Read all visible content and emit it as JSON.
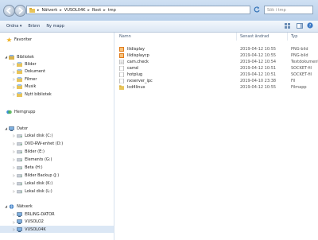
{
  "address": {
    "crumbs": [
      "Nätverk",
      "VUSOL04K",
      "Root",
      "tmp"
    ],
    "search_placeholder": "Sök i tmp"
  },
  "toolbar": {
    "organize": "Ordna ▾",
    "burn": "Bränn",
    "new_folder": "Ny mapp"
  },
  "navigation": {
    "favorites": "Favoriter",
    "libraries": "Bibliotek",
    "library_items": [
      "Bilder",
      "Dokument",
      "Filmer",
      "Musik",
      "Nytt bibliotek"
    ],
    "homegroup": "Hemgrupp",
    "computer": "Dator",
    "drives": [
      "Lokal disk (C:)",
      "DVD-RW-enhet (D:)",
      "Bilder (E:)",
      "Elements (G:)",
      "Beta (H:)",
      "Bilder Backup (J:)",
      "Lokal disk (K:)",
      "Lokal disk (L:)"
    ],
    "network": "Nätverk",
    "network_items": [
      "ERLING-DATOR",
      "VUSOLO2",
      "VUSOL04K"
    ]
  },
  "columns": {
    "name": "Namn",
    "date": "Senast ändrad",
    "type": "Typ"
  },
  "files": [
    {
      "name": "lildisplay",
      "date": "2019-04-12 10:55",
      "type": "PNG-bild",
      "icon": "png-image-icon"
    },
    {
      "name": "lildisplaycp",
      "date": "2019-04-12 10:55",
      "type": "PNG-bild",
      "icon": "png-image-icon"
    },
    {
      "name": "cam.check",
      "date": "2019-04-12 10:54",
      "type": "Textdokument",
      "icon": "text-document-icon"
    },
    {
      "name": "camd",
      "date": "2019-04-12 10:51",
      "type": "SOCKET-fil",
      "icon": "file-icon"
    },
    {
      "name": "hotplug",
      "date": "2019-04-12 10:51",
      "type": "SOCKET-fil",
      "icon": "file-icon"
    },
    {
      "name": "nxserver_ipc",
      "date": "2019-04-10 23:38",
      "type": "Fil",
      "icon": "file-icon"
    },
    {
      "name": "lcd4linux",
      "date": "2019-04-12 10:55",
      "type": "Filmapp",
      "icon": "folder-icon"
    }
  ],
  "colors": {
    "toolbar_top": "#f3f7fc",
    "selection": "#dbe7f5",
    "folder": "#e8c45a"
  }
}
